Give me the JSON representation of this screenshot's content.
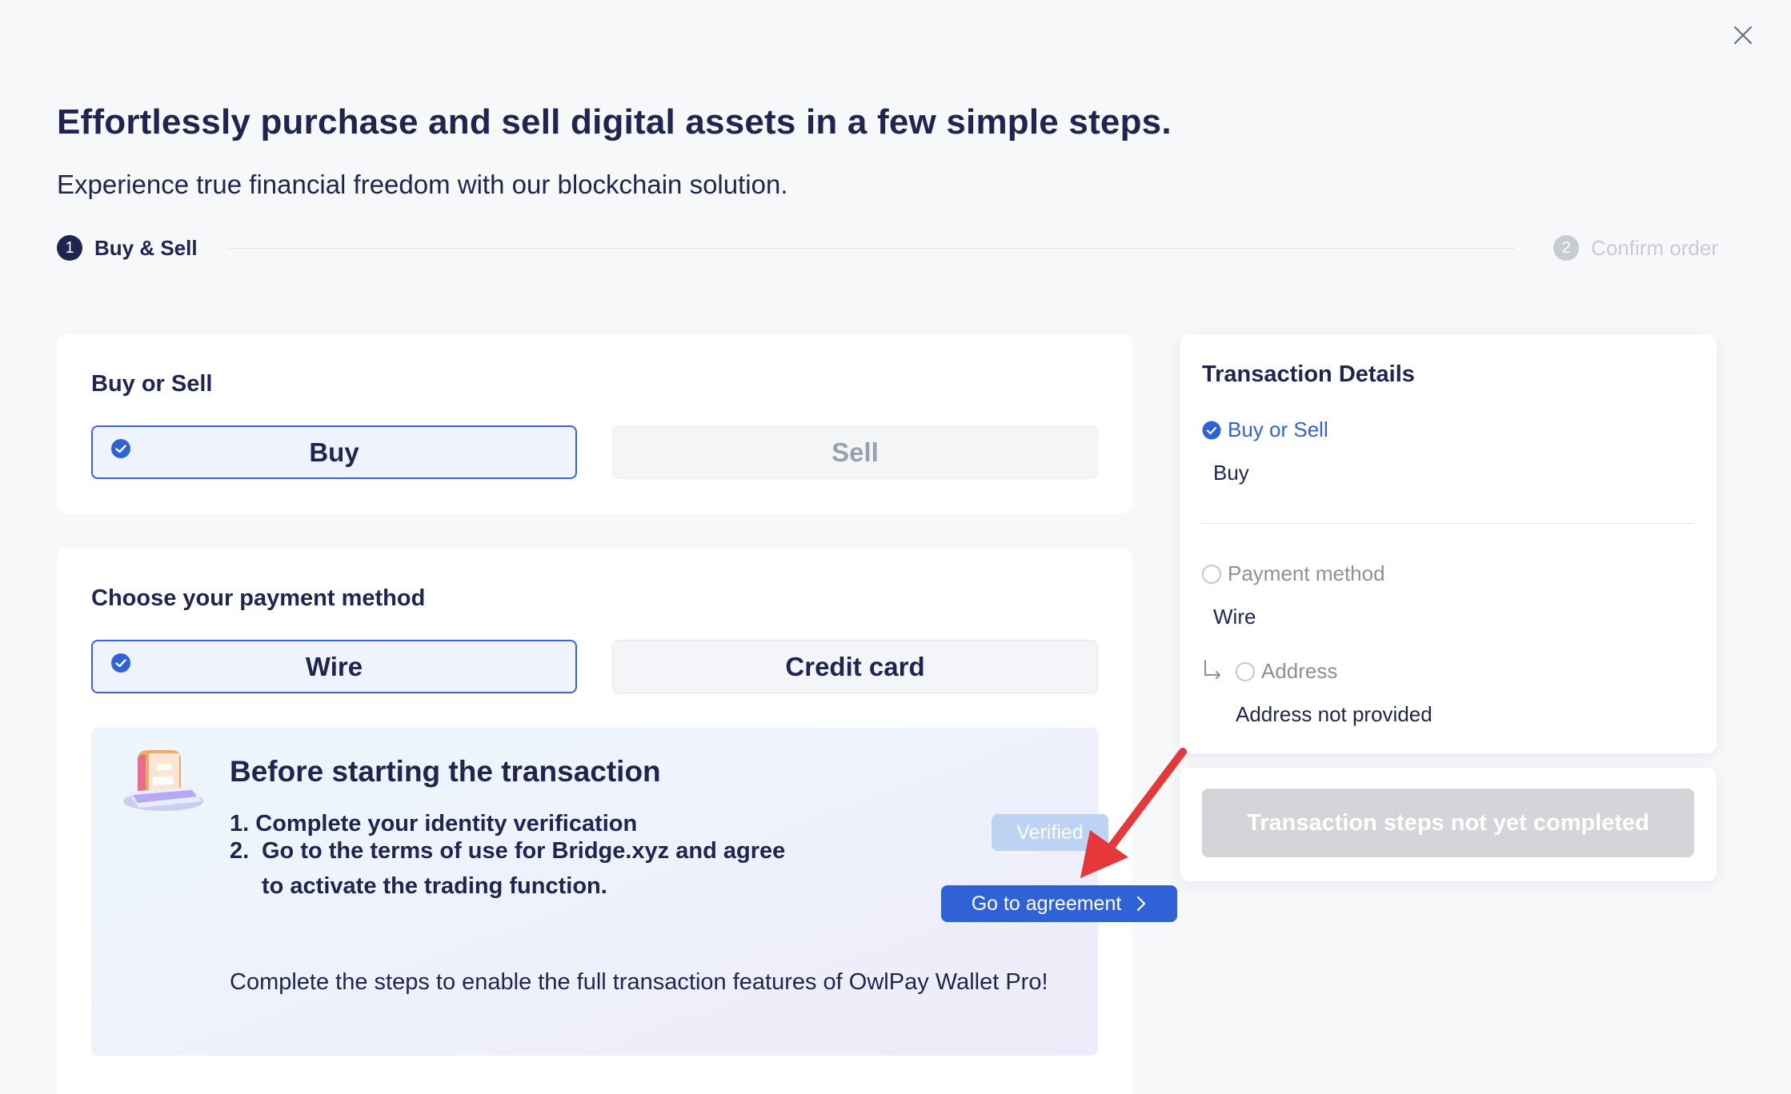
{
  "title": "Effortlessly purchase and sell digital assets in a few simple steps.",
  "subtitle": "Experience true financial freedom with our blockchain solution.",
  "stepper": {
    "steps": [
      {
        "number": "1",
        "label": "Buy & Sell",
        "state": "active"
      },
      {
        "number": "2",
        "label": "Confirm order",
        "state": "inactive"
      }
    ]
  },
  "buy_sell": {
    "heading": "Buy or Sell",
    "options": [
      {
        "label": "Buy",
        "selected": true
      },
      {
        "label": "Sell",
        "selected": false
      }
    ]
  },
  "payment": {
    "heading": "Choose your payment method",
    "options": [
      {
        "label": "Wire",
        "selected": true
      },
      {
        "label": "Credit card",
        "selected": false
      }
    ]
  },
  "notice": {
    "title": "Before starting the transaction",
    "items": [
      {
        "number": "1.",
        "text": "Complete your identity verification",
        "status": "Verified"
      },
      {
        "number": "2.",
        "text": "Go to the terms of use for Bridge.xyz and agree to activate the trading function.",
        "action": "Go to agreement"
      }
    ],
    "footer": "Complete the steps to enable the full transaction features of OwlPay Wallet Pro!"
  },
  "details": {
    "title": "Transaction Details",
    "rows": [
      {
        "label": "Buy or Sell",
        "value": "Buy",
        "state": "checked"
      },
      {
        "label": "Payment method",
        "value": "Wire",
        "state": "unchecked"
      },
      {
        "label": "Address",
        "value": "Address not provided",
        "state": "unchecked"
      }
    ]
  },
  "submit_label": "Transaction steps not yet completed",
  "colors": {
    "primary": "#2f62d6",
    "navy": "#1e2550",
    "annotation_arrow": "#e5383b"
  },
  "icons": [
    "close-icon",
    "check-circle-icon",
    "chevron-right-icon",
    "document-illustration-icon",
    "sub-arrow-icon",
    "annotation-arrow-icon"
  ]
}
